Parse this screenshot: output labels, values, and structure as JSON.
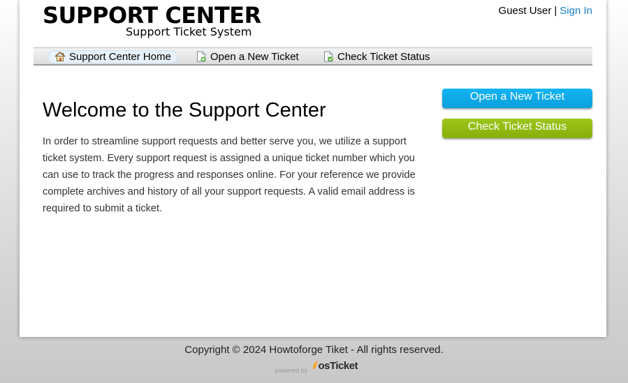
{
  "header": {
    "logo_title": "SUPPORT CENTER",
    "logo_subtitle": "Support Ticket System",
    "user_label": "Guest User",
    "separator": "|",
    "sign_in": "Sign In"
  },
  "nav": {
    "items": [
      {
        "label": "Support Center Home",
        "icon": "home-icon",
        "active": true
      },
      {
        "label": "Open a New Ticket",
        "icon": "new-ticket-icon",
        "active": false
      },
      {
        "label": "Check Ticket Status",
        "icon": "ticket-status-icon",
        "active": false
      }
    ]
  },
  "main": {
    "title": "Welcome to the Support Center",
    "body": "In order to streamline support requests and better serve you, we utilize a support ticket system. Every support request is assigned a unique ticket number which you can use to track the progress and responses online. For your reference we provide complete archives and history of all your support requests. A valid email address is required to submit a ticket."
  },
  "sidebar": {
    "open_ticket_label": "Open a New Ticket",
    "check_status_label": "Check Ticket Status"
  },
  "footer": {
    "copyright": "Copyright © 2024 Howtoforge Tiket - All rights reserved.",
    "powered_by": "powered by",
    "osticket": "osTicket"
  },
  "colors": {
    "link": "#1c80c4",
    "open_button": "#0aa0de",
    "status_button": "#86b00a"
  }
}
